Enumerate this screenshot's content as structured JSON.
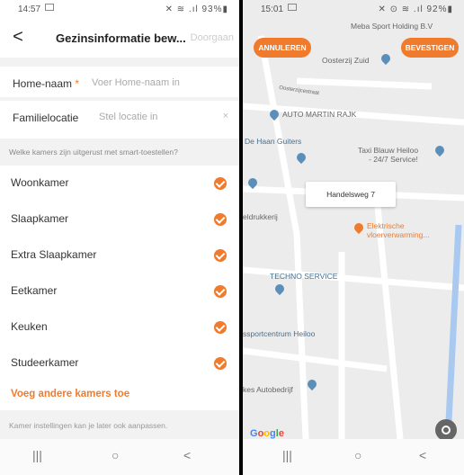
{
  "left": {
    "status": {
      "time": "14:57",
      "icons": "✕ ≋ .ıl 93%▮"
    },
    "header": {
      "back": "<",
      "title": "Gezinsinformatie bew...",
      "next": "Doorgaan"
    },
    "home_name": {
      "label": "Home-naam",
      "required_mark": "*",
      "placeholder": "Voer Home-naam in"
    },
    "family_location": {
      "label": "Familielocatie",
      "placeholder": "Stel locatie in",
      "clear": "×"
    },
    "question": "Welke kamers zijn uitgerust met smart-toestellen?",
    "rooms": [
      {
        "name": "Woonkamer",
        "checked": true
      },
      {
        "name": "Slaapkamer",
        "checked": true
      },
      {
        "name": "Extra Slaapkamer",
        "checked": true
      },
      {
        "name": "Eetkamer",
        "checked": true
      },
      {
        "name": "Keuken",
        "checked": true
      },
      {
        "name": "Studeerkamer",
        "checked": true
      }
    ],
    "add_rooms": "Voeg andere kamers toe",
    "footer_note": "Kamer instellingen kan je later ook aanpassen.",
    "nav": {
      "recents": "|||",
      "home": "○",
      "back": "<"
    }
  },
  "right": {
    "status": {
      "time": "15:01",
      "icons": "✕ ⊙ ≋ .ıl 92%▮"
    },
    "buttons": {
      "cancel": "ANNULEREN",
      "confirm": "BEVESTIGEN"
    },
    "map_labels": {
      "meba": "Meba Sport Holding B.V",
      "oosterzij": "Oosterzij Zuid",
      "straat": "Oosterzijcestraat",
      "auto_martin": "AUTO MARTIN RAJK",
      "de_haan": "De Haan Guiters",
      "taxi_line1": "Taxi Blauw Heiloo",
      "taxi_line2": "- 24/7 Service!",
      "drukkerij": "eldrukkerij",
      "elektrische_line1": "Elektrische",
      "elektrische_line2": "vloerverwarming...",
      "techno": "TECHNO SERVICE",
      "sportcentrum": "ssportcentrum Heiloo",
      "autobedrijf": "kes Autobedrijf"
    },
    "address_card": "Handelsweg 7",
    "google": {
      "g1": "G",
      "g2": "o",
      "g3": "o",
      "g4": "g",
      "g5": "l",
      "g6": "e"
    },
    "nav": {
      "recents": "|||",
      "home": "○",
      "back": "<"
    }
  },
  "colors": {
    "accent": "#f07b2c",
    "map_bg": "#ececec",
    "pin_blue": "#5b8fb9"
  }
}
